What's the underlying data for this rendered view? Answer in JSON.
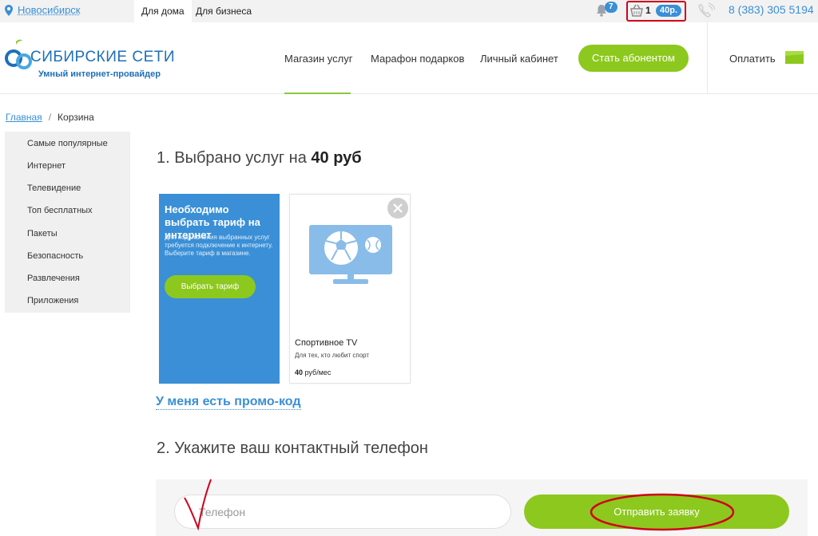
{
  "topbar": {
    "city": "Новосибирск",
    "tabs": [
      {
        "label": "Для дома",
        "active": true
      },
      {
        "label": "Для бизнеса",
        "active": false
      }
    ],
    "notifications_count": "7",
    "cart_count": "1",
    "cart_sum": "40р.",
    "phone": "8 (383) 305 5194"
  },
  "header": {
    "logo_name": "СИБИРСКИЕ СЕТИ",
    "logo_tagline": "Умный интернет-провайдер",
    "nav": [
      {
        "label": "Магазин услуг",
        "active": true
      },
      {
        "label": "Марафон подарков",
        "active": false
      },
      {
        "label": "Личный кабинет",
        "active": false
      }
    ],
    "cta": "Стать абонентом",
    "pay": "Оплатить"
  },
  "breadcrumb": {
    "home": "Главная",
    "separator": "/",
    "current": "Корзина"
  },
  "sidebar": {
    "items": [
      {
        "label": "Самые популярные"
      },
      {
        "label": "Интернет"
      },
      {
        "label": "Телевидение"
      },
      {
        "label": "Топ бесплатных"
      },
      {
        "label": "Пакеты"
      },
      {
        "label": "Безопасность"
      },
      {
        "label": "Развлечения"
      },
      {
        "label": "Приложения"
      }
    ]
  },
  "step1": {
    "title_prefix": "1. Выбрано услуг на",
    "total": "40 руб"
  },
  "tariff_card": {
    "title": "Необходимо выбрать тариф на интернет",
    "text": "Для подключения выбранных услуг требуется подключение к интернету. Выберите тариф в магазине.",
    "button": "Выбрать тариф"
  },
  "service_card": {
    "name": "Спортивное TV",
    "description": "Для тех, кто любит спорт",
    "price_value": "40",
    "price_unit": "руб/мес"
  },
  "promo_link": "У меня есть промо-код",
  "step2": {
    "title": "2. Укажите ваш контактный телефон",
    "phone_placeholder": "Телефон",
    "submit": "Отправить заявку"
  },
  "colors": {
    "accent_blue": "#3a8fd6",
    "accent_green": "#8dc81e",
    "annotation_red": "#d0021b"
  }
}
